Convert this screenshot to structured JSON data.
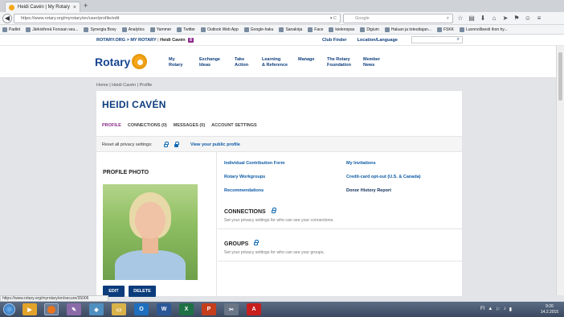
{
  "browser": {
    "tab_title": "Heidi Cavén | My Rotary",
    "tab_close": "×",
    "new_tab": "+",
    "back": "◀",
    "url": "https://www.rotary.org/myrotary/en/user/profile/edit",
    "url_actions": "▾ C",
    "search_placeholder": "Google",
    "search_icon": "search-icon",
    "toolbar_icons": [
      "star-icon",
      "clipboard-icon",
      "download-icon",
      "home-icon",
      "send-icon",
      "extension-icon",
      "smiley-icon",
      "menu-icon"
    ],
    "toolbar_glyphs": [
      "☆",
      "▤",
      "⬇",
      "⌂",
      "➤",
      "⚑",
      "☺",
      "≡"
    ]
  },
  "bookmarks": [
    "Padlet",
    "Järkivihreä Forssan seu...",
    "Synergia Boxy",
    "Analytics",
    "Yammer",
    "Twitter",
    "Outlook Web App",
    "Google-haku",
    "Sanakirja",
    "Face",
    "kielenopas",
    "Digium",
    "Haluan ja toteuttajan...",
    "FSKK",
    "Luonnollisesti ihon hy..."
  ],
  "rotary_top": {
    "crumb": "ROTARY.ORG > MY ROTARY",
    "user": "Heidi Cavén",
    "user_badge": "8",
    "club_finder": "Club Finder",
    "location_language": "Location/Language",
    "search_icon": "search-icon",
    "search_glyph": "⌕"
  },
  "header": {
    "logo_text": "Rotary",
    "nav": [
      "My\nRotary",
      "Exchange\nIdeas",
      "Take\nAction",
      "Learning\n& Reference",
      "Manage",
      "The Rotary\nFoundation",
      "Member\nNews"
    ]
  },
  "profile": {
    "breadcrumb": "Home | Heidi Cavén | Profile",
    "name": "HEIDI CAVÉN",
    "tabs": [
      "PROFILE",
      "CONNECTIONS (0)",
      "MESSAGES (0)",
      "ACCOUNT SETTINGS"
    ],
    "privacy_label": "Reset all privacy settings:",
    "public_profile_link": "View your public profile",
    "photo_title": "PROFILE PHOTO",
    "edit_button": "EDIT",
    "delete_button": "DELETE",
    "links_left": [
      "Individual Contribution Form",
      "Rotary Workgroups",
      "Recommendations"
    ],
    "links_right": [
      "My Invitations",
      "Credit-card opt-out (U.S. & Canada)",
      "Donor History Report"
    ],
    "connections_title": "CONNECTIONS",
    "connections_sub": "Set your privacy settings for who can see your connections.",
    "groups_title": "GROUPS",
    "groups_sub": "Set your privacy settings for who can see your groups."
  },
  "statusbar": {
    "text": "https://www.rotary.org/myrotary/en/secure/35006"
  },
  "taskbar": {
    "apps": [
      "start-orb",
      "media-player",
      "firefox",
      "paint",
      "network",
      "explorer",
      "outlook",
      "word",
      "excel",
      "powerpoint",
      "snipping-tool",
      "acrobat"
    ],
    "app_glyphs": [
      "",
      "▶",
      "●",
      "✎",
      "◈",
      "▭",
      "O",
      "W",
      "X",
      "P",
      "✂",
      "A"
    ],
    "tray": [
      "FI",
      "▲",
      "⚐",
      "♪",
      "▮"
    ],
    "time": "9:26",
    "date": "14.2.2015"
  }
}
